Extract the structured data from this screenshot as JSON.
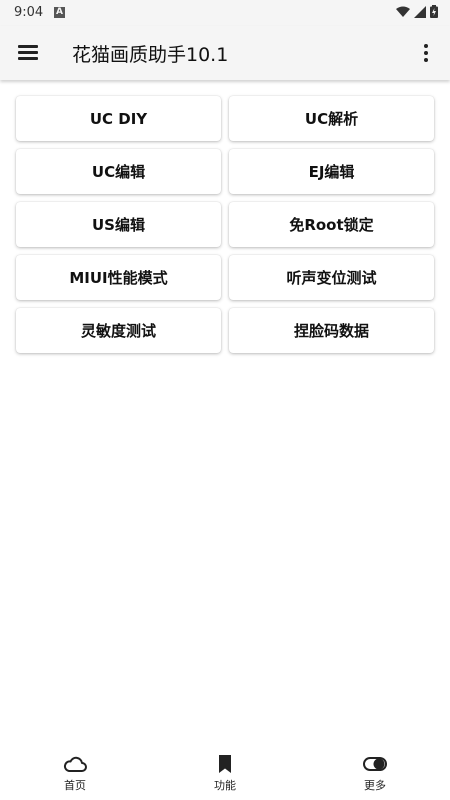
{
  "status_bar": {
    "time": "9:04",
    "notification_icon": "A"
  },
  "app_bar": {
    "title": "花猫画质助手10.1"
  },
  "features": [
    {
      "label": "UC DIY"
    },
    {
      "label": "UC解析"
    },
    {
      "label": "UC编辑"
    },
    {
      "label": "EJ编辑"
    },
    {
      "label": "US编辑"
    },
    {
      "label": "免Root锁定"
    },
    {
      "label": "MIUI性能模式"
    },
    {
      "label": "听声变位测试"
    },
    {
      "label": "灵敏度测试"
    },
    {
      "label": "捏脸码数据"
    }
  ],
  "bottom_nav": {
    "items": [
      {
        "label": "首页",
        "icon": "cloud-icon"
      },
      {
        "label": "功能",
        "icon": "bookmark-icon"
      },
      {
        "label": "更多",
        "icon": "toggle-icon"
      }
    ]
  },
  "colors": {
    "bar_bg": "#f5f5f5",
    "text": "#111111",
    "card_bg": "#ffffff"
  }
}
